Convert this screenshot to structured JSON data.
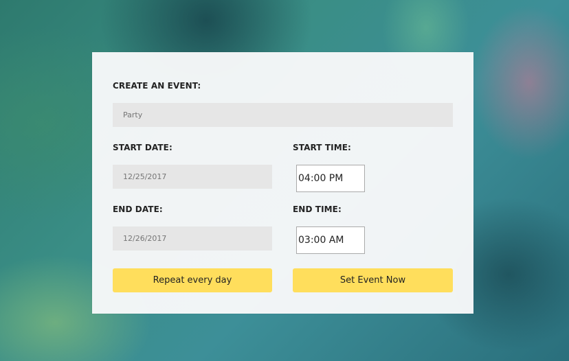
{
  "form": {
    "event_label": "CREATE AN EVENT:",
    "event_placeholder": "Party",
    "start_date_label": "START DATE:",
    "start_date_value": "12/25/2017",
    "start_time_label": "START TIME:",
    "start_time_value": "04:00 PM",
    "end_date_label": "END DATE:",
    "end_date_value": "12/26/2017",
    "end_time_label": "END TIME:",
    "end_time_value": "03:00 AM",
    "repeat_button_label": "Repeat every day",
    "set_event_button_label": "Set Event Now"
  },
  "colors": {
    "button_bg": "#ffde5c",
    "field_bg": "#e6e6e6",
    "card_bg": "#f7f8f9"
  }
}
